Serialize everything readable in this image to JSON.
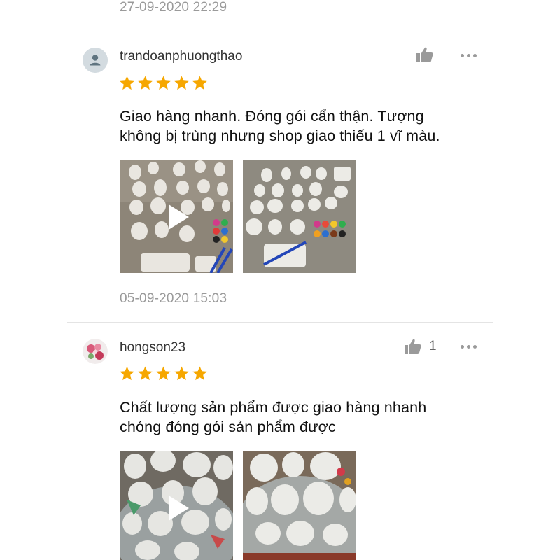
{
  "colors": {
    "star": "#f6a700",
    "muted": "#9a9a9a",
    "divider": "#e4e4e4"
  },
  "prev_review": {
    "date": "27-09-2020 22:29"
  },
  "reviews": [
    {
      "username": "trandoanphuongthao",
      "rating": 5,
      "comment_lines": [
        "Giao hàng nhanh. Đóng gói cẩn thận. Tượng",
        "không bị trùng nhưng shop giao thiếu 1 vĩ màu."
      ],
      "media": [
        "video-thumbnail",
        "photo"
      ],
      "date": "05-09-2020 15:03",
      "likes": "",
      "icons": [
        "avatar-default-icon",
        "thumbs-up-icon",
        "more-icon"
      ]
    },
    {
      "username": "hongson23",
      "rating": 5,
      "comment_lines": [
        "Chất lượng sản phẩm được giao hàng nhanh",
        "chóng đóng gói sản phẩm được"
      ],
      "media": [
        "video-thumbnail",
        "photo"
      ],
      "likes": "1",
      "icons": [
        "avatar-photo",
        "thumbs-up-icon",
        "more-icon"
      ]
    }
  ]
}
